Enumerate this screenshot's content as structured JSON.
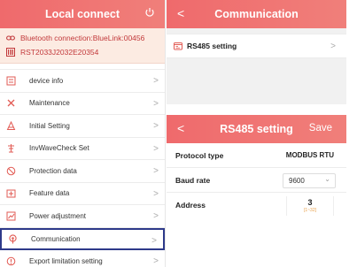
{
  "left": {
    "header": {
      "title": "Local connect"
    },
    "device": {
      "bluetooth": "Bluetooth connection:BlueLink:00456",
      "serial": "RST2033J2032E20354"
    },
    "menu": [
      {
        "label": "device info"
      },
      {
        "label": "Maintenance"
      },
      {
        "label": "Initial Setting"
      },
      {
        "label": "InvWaveCheck Set"
      },
      {
        "label": "Protection data"
      },
      {
        "label": "Feature data"
      },
      {
        "label": "Power adjustment"
      },
      {
        "label": "Communication"
      },
      {
        "label": "Export limitation setting"
      }
    ]
  },
  "communication": {
    "header": {
      "title": "Communication"
    },
    "item": {
      "label": "RS485 setting"
    }
  },
  "rs485": {
    "header": {
      "title": "RS485 setting",
      "save": "Save"
    },
    "protocol": {
      "label": "Protocol type",
      "value": "MODBUS RTU"
    },
    "baud": {
      "label": "Baud rate",
      "value": "9600"
    },
    "address": {
      "label": "Address",
      "value": "3",
      "range": "[1~32]"
    }
  },
  "colors": {
    "accent": "#ef6a6c",
    "selection": "#2e3a8a",
    "device_bg": "#fcebe2",
    "device_text": "#c2383a"
  }
}
